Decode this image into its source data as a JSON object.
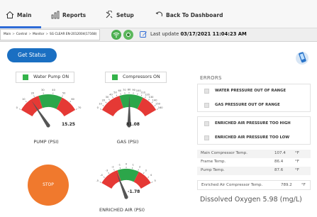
{
  "nav": {
    "main": "Main",
    "reports": "Reports",
    "setup": "Setup",
    "back": "Back To Dashboard"
  },
  "breadcrumb": {
    "items": [
      "Main",
      "Control",
      "Monitor",
      "SG CLEAR EN-2012004(17168)"
    ]
  },
  "last_update": {
    "label": "Last update",
    "value": "03/17/2021 11:04:23 AM"
  },
  "actions": {
    "get_status": "Get Status",
    "stop": "STOP"
  },
  "indicators": {
    "pump": "Water Pump ON",
    "compressors": "Compressors ON",
    "color_on": "#34b34a"
  },
  "gauges": {
    "pump": {
      "label": "PUMP (PSI)",
      "value": 15.25,
      "value_text": "15.25",
      "min": 0,
      "max": 70,
      "ticks": [
        "0",
        "10",
        "20",
        "30",
        "40",
        "50",
        "60",
        "70"
      ]
    },
    "gas": {
      "label": "GAS (PSI)",
      "value": 81.08,
      "value_text": "81.08",
      "min": 0,
      "max": 160,
      "ticks": [
        "0",
        "10",
        "20",
        "30",
        "40",
        "50",
        "60",
        "70",
        "80",
        "90",
        "100",
        "110",
        "120",
        "130",
        "140",
        "150",
        "160"
      ]
    },
    "air": {
      "label": "ENRICHED AIR (PSI)",
      "value": -1.78,
      "value_text": "-1.78",
      "min": -5,
      "max": 5,
      "ticks": [
        "-5",
        "-4",
        "-3",
        "-2",
        "-1",
        "0",
        "1",
        "2",
        "3",
        "4",
        "5"
      ]
    },
    "colors": {
      "red": "#e53935",
      "green": "#2ca64a",
      "needle": "#555555"
    }
  },
  "errors": {
    "title": "ERRORS",
    "group1": [
      "WATER PRESSURE OUT OF RANGE",
      "GAS PRESSURE OUT OF RANGE"
    ],
    "group2": [
      "ENRICHED AIR PRESSURE TOO HIGH",
      "ENRICHED AIR PRESSURE TOO LOW"
    ]
  },
  "temps": [
    {
      "name": "Main Compressor Temp.",
      "value": "107.4",
      "unit": "°F"
    },
    {
      "name": "Frame Temp.",
      "value": "86.4",
      "unit": "°F"
    },
    {
      "name": "Pump Temp.",
      "value": "87.6",
      "unit": "°F"
    }
  ],
  "air_temp": {
    "name": "Enriched Air Compressor Temp.",
    "value": "789.2",
    "unit": "°F"
  },
  "oxygen": "Dissolved Oxygen 5.98 (mg/L)"
}
